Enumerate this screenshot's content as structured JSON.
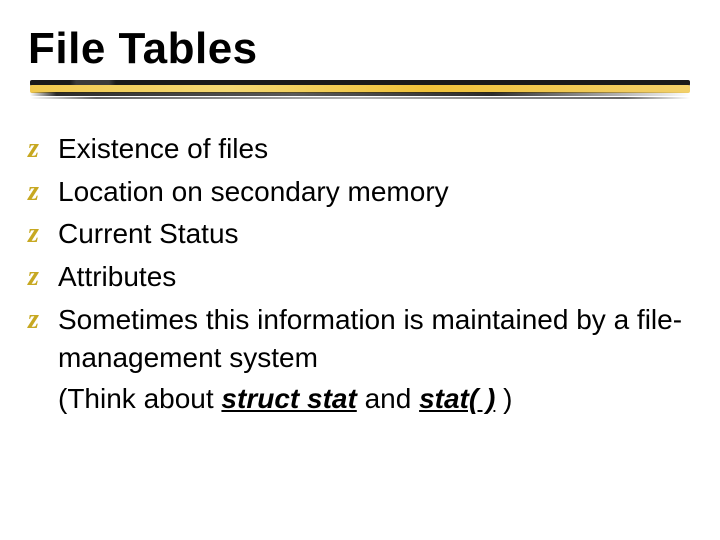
{
  "title": "File Tables",
  "bullet_char": "z",
  "bullets": [
    {
      "text": "Existence of files"
    },
    {
      "text": "Location on secondary memory"
    },
    {
      "text": "Current Status"
    },
    {
      "text": "Attributes"
    },
    {
      "text": "Sometimes this information is maintained by a file-management system",
      "sub_prefix": "(Think about ",
      "em1": "struct stat",
      "sub_mid": "  and ",
      "em2": "stat( )",
      "sub_suffix": " )"
    }
  ]
}
